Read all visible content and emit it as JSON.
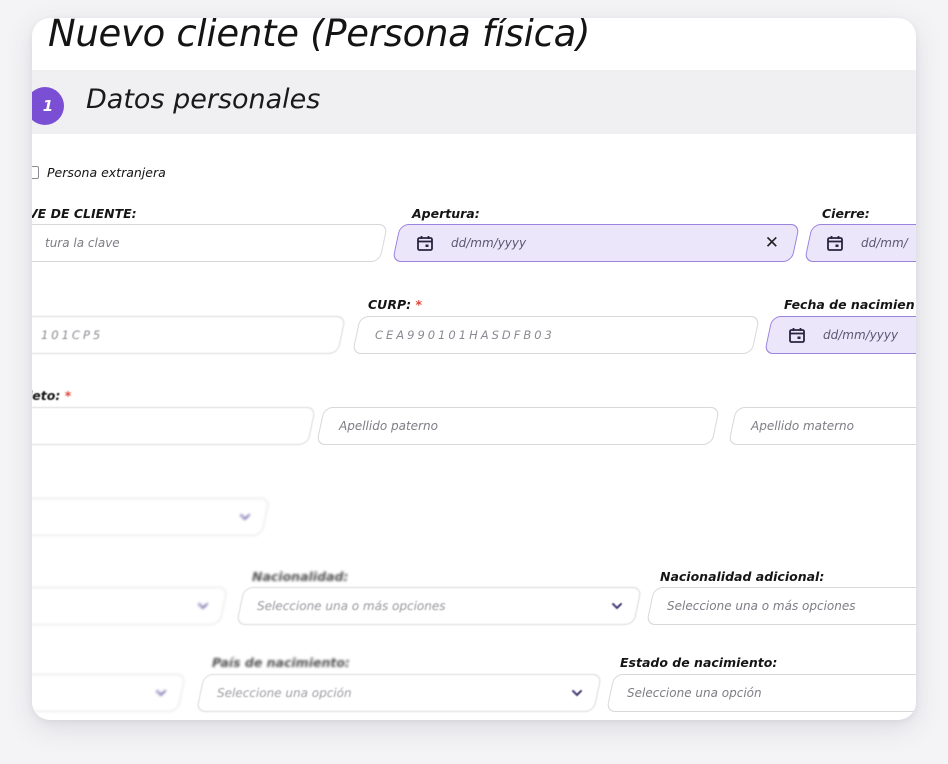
{
  "page": {
    "title": "Nuevo cliente (Persona física)"
  },
  "section": {
    "number": "1",
    "title": "Datos personales"
  },
  "foreign": {
    "label": "Persona extranjera"
  },
  "fields": {
    "clave_label": "VE DE CLIENTE:",
    "clave_placeholder": "tura la clave",
    "apertura_label": "Apertura:",
    "apertura_placeholder": "dd/mm/yyyy",
    "apertura_clear": "✕",
    "cierre_label": "Cierre:",
    "cierre_placeholder": "dd/mm/",
    "rfc_value": "101CP5",
    "curp_label": "CURP:",
    "curp_required": "*",
    "curp_value": "CEA990101HASDFB03",
    "fecha_nac_label": "Fecha de nacimien",
    "fecha_nac_placeholder": "dd/mm/yyyy",
    "nombre_label": "leto:",
    "nombre_required": "*",
    "apellido_paterno_placeholder": "Apellido paterno",
    "apellido_materno_placeholder": "Apellido materno",
    "nacionalidad_label": "Nacionalidad:",
    "nacionalidad_placeholder": "Seleccione una o más opciones",
    "nacionalidad_adicional_label": "Nacionalidad adicional:",
    "nacionalidad_adicional_placeholder": "Seleccione una o más opciones",
    "pais_nac_label": "País de nacimiento:",
    "pais_nac_placeholder": "Seleccione una opción",
    "estado_nac_label": "Estado de nacimiento:",
    "estado_nac_placeholder": "Seleccione una opción"
  },
  "colors": {
    "accent": "#7a4fd3",
    "date_bg": "#ece6fb",
    "required": "#e0473a"
  }
}
